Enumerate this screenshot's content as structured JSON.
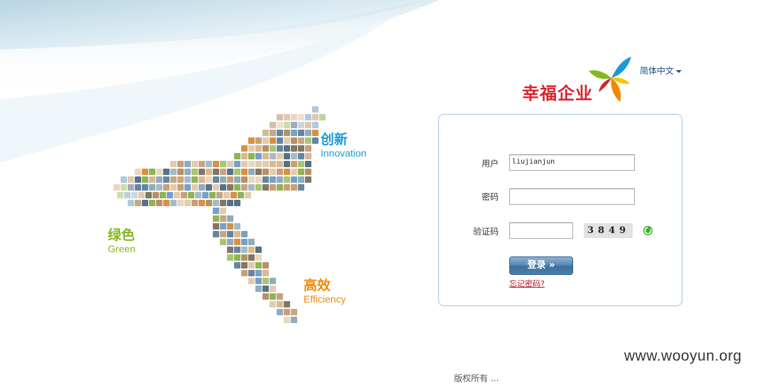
{
  "language": {
    "label": "简体中文"
  },
  "brand": {
    "name": "幸福企业"
  },
  "slogans": {
    "innovation": {
      "cn": "创新",
      "en": "Innovation"
    },
    "green": {
      "cn": "绿色",
      "en": "Green"
    },
    "efficiency": {
      "cn": "高效",
      "en": "Efficiency"
    }
  },
  "login": {
    "username_label": "用户",
    "username_value": "liujianjun",
    "password_label": "密码",
    "password_value": "",
    "captcha_label": "验证码",
    "captcha_input_value": "",
    "captcha_text": "3849",
    "submit_label": "登录 »",
    "forgot_label": "忘记密码?"
  },
  "watermark": "www.wooyun.org",
  "footer": {
    "text": "版权所有 ...",
    "badge": ""
  },
  "colors": {
    "brand_red": "#d6232b",
    "innovation_blue": "#1a9ad6",
    "green": "#84b81a",
    "efficiency_orange": "#f08a00",
    "panel_border": "#a9c8e6",
    "button_blue": "#4b7fab"
  }
}
